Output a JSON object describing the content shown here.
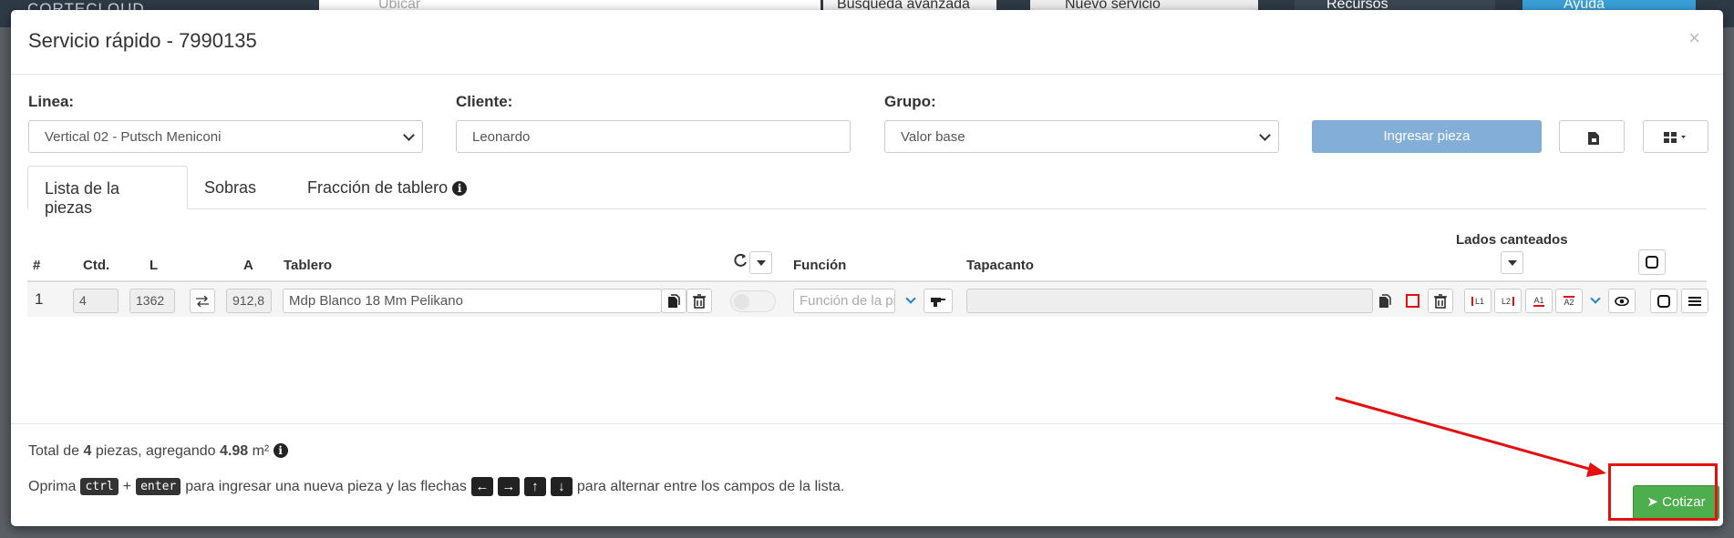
{
  "background": {
    "logo": "CORTECLOUD",
    "search_placeholder": "Ubicar",
    "advanced_search": "Búsqueda avanzada",
    "new_service": "Nuevo servicio",
    "resources": "Recursos",
    "help": "Ayuda"
  },
  "modal": {
    "title": "Servicio rápido - 7990135",
    "close": "×"
  },
  "form": {
    "linea_label": "Linea:",
    "linea_value": "Vertical 02 - Putsch Meniconi",
    "cliente_label": "Cliente:",
    "cliente_value": "Leonardo",
    "grupo_label": "Grupo:",
    "grupo_value": "Valor base",
    "ingresar_button": "Ingresar pieza"
  },
  "tabs": [
    {
      "label": "Lista de la piezas"
    },
    {
      "label": "Sobras"
    },
    {
      "label": "Fracción de tablero"
    }
  ],
  "table": {
    "headers": {
      "num": "#",
      "ctd": "Ctd.",
      "l": "L",
      "a": "A",
      "tablero": "Tablero",
      "funcion": "Función",
      "tapacanto": "Tapacanto",
      "lados": "Lados canteados"
    },
    "row": {
      "num": "1",
      "ctd": "4",
      "l": "1362",
      "a": "912,8",
      "tablero": "Mdp Blanco 18 Mm Pelikano",
      "funcion_placeholder": "Función de la pieza",
      "edges": [
        "L1",
        "L2",
        "A1",
        "A2"
      ]
    }
  },
  "footer": {
    "total_prefix": "Total de",
    "pieces": "4",
    "total_mid": "piezas, agregando",
    "area": "4.98",
    "unit": "m²",
    "hint_prefix": "Oprima",
    "key_ctrl": "ctrl",
    "plus": "+",
    "key_enter": "enter",
    "hint_mid": "para ingresar una nueva pieza y las flechas",
    "hint_suffix": "para alternar entre los campos de la lista.",
    "cotizar_button": "Cotizar"
  },
  "colors": {
    "primary_light": "#82aed8",
    "success": "#4cae4c",
    "annotation_red": "#e3100f"
  }
}
